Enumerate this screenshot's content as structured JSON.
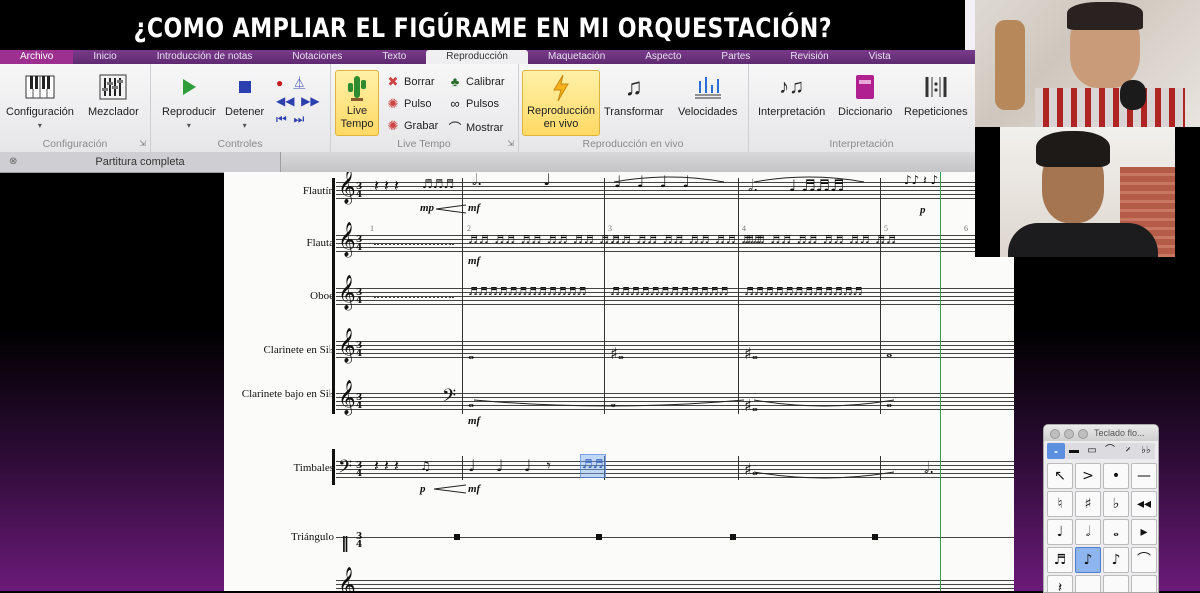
{
  "banner": {
    "title": "¿COMO AMPLIAR EL FIGÚRAME EN MI ORQUESTACIÓN?"
  },
  "ribbon_tabs": [
    "Archivo",
    "Inicio",
    "Introducción de notas",
    "Notaciones",
    "Texto",
    "Reproducción",
    "Maquetación",
    "Aspecto",
    "Partes",
    "Revisión",
    "Vista"
  ],
  "active_tab": "Reproducción",
  "groups": {
    "configuracion": {
      "title": "Configuración",
      "buttons": [
        "Configuración",
        "Mezclador"
      ]
    },
    "controles": {
      "title": "Controles",
      "buttons": [
        "Reproducir",
        "Detener"
      ]
    },
    "live_tempo": {
      "title": "Live Tempo",
      "big_button": "Live Tempo",
      "small": [
        "Borrar",
        "Pulso",
        "Grabar",
        "Calibrar",
        "Pulsos",
        "Mostrar"
      ]
    },
    "reproduccion_en_vivo": {
      "title": "Reproducción en vivo",
      "buttons": [
        "Reproducción en vivo",
        "Transformar",
        "Velocidades"
      ]
    },
    "interpretacion": {
      "title": "Interpretación",
      "buttons": [
        "Interpretación",
        "Diccionario",
        "Repeticiones"
      ]
    }
  },
  "document_tab": "Partitura completa",
  "instruments": [
    "Flautín",
    "Flauta",
    "Oboe",
    "Clarinete en Si♭",
    "Clarinete bajo en Si♭",
    "Timbales",
    "Triángulo"
  ],
  "dynamics": [
    "mp",
    "mf",
    "p",
    "mf",
    "mf",
    "p",
    "mf",
    "p"
  ],
  "measure_numbers": [
    "1",
    "2",
    "3",
    "4",
    "5",
    "6"
  ],
  "keypad": {
    "title": "Teclado flo...",
    "tabs": [
      "𝅝",
      "▬",
      "▭",
      "⌒",
      "𝄎",
      "♭♭"
    ],
    "keys": [
      "↖",
      ">",
      "•",
      "—",
      "♮",
      "♯",
      "♭",
      "◂◂",
      "♩",
      "𝅗𝅥",
      "𝅝",
      "▸",
      "♬",
      "♪",
      "♪",
      "⌒",
      "𝄽",
      "",
      "",
      ""
    ]
  },
  "colors": {
    "ribbon_purple": "#6b2e7e",
    "highlight_yellow": "#ffd964",
    "selection_blue": "#78aaf0"
  }
}
